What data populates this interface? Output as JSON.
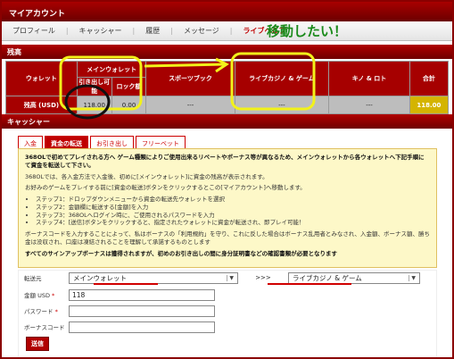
{
  "title": "マイアカウント",
  "nav": [
    "プロフィール",
    "キャッシャー",
    "履歴",
    "メッセージ",
    "ライブヘルプ"
  ],
  "nav_active_index": 4,
  "handwritten_note": "移動したい！",
  "balance": {
    "header": "残高",
    "col_wallet": "ウォレット",
    "col_main": "メインウォレット",
    "col_withdrawable": "引き出し可能",
    "col_locked": "ロック額",
    "col_sportsbook": "スポーツブック",
    "col_live_casino": "ライブカジノ & ゲーム",
    "col_keno": "キノ & ロト",
    "col_total": "合計",
    "row_label": "残高 (USD)",
    "withdrawable": "118.00",
    "locked": "0.00",
    "sportsbook": "---",
    "live_casino": "---",
    "keno": "---",
    "total": "118.00"
  },
  "cashier": {
    "header": "キャッシャー",
    "tabs": [
      "入金",
      "資金の転送",
      "お引き出し",
      "フリーベット"
    ],
    "active_tab": 1
  },
  "info": {
    "p1": "368OLで初めてプレイされる方へ ゲーム種類によりご使用出来るリベートやボーナス等が異なるため、メインウォレットから各ウォレットへ下記手順にて資金を転送して下さい。",
    "p2": "368OLでは、各入金方法で入金後、初めに[メインウォレット]に資金の残高が表示されます。",
    "p3": "お好みのゲームをプレイする前に[資金の転送]ボタンをクリックするとこの[マイアカウント]へ移動します。",
    "steps": [
      "ステップ1：ドロップダウンメニューから資金の転送先ウォレットを選択",
      "ステップ2：金額欄に転送する[金額]を入力",
      "ステップ3：368OLへログイン時に、ご使用されるパスワードを入力",
      "ステップ4：[送信]ボタンをクリックすると、指定されたウォレットに資金が転送され、即プレイ可能！"
    ],
    "p4": "ボーナスコードを入力することによって、私はボーナスの「利用規約」を守り、これに反した場合はボーナス乱用者とみなされ、入金額、ボーナス額、勝ち金は没収され、口座は凍結されることを理解して承諾するものとします",
    "p5": "すべてのサインアップボーナスは獲得されますが、初めのお引き出しの間に身分証明書などの確認書類が必要となります"
  },
  "form": {
    "from_label": "転送元",
    "from_value": "メインウォレット",
    "arrow_text": ">>>",
    "to_value": "ライブカジノ & ゲーム",
    "amount_label": "金額 USD",
    "amount_value": "118",
    "password_label": "パスワード",
    "bonus_label": "ボーナスコード",
    "submit_label": "送信",
    "required_mark": "*"
  },
  "colors": {
    "brand_red": "#c00000",
    "annotation_yellow": "#f2f21a",
    "annotation_green": "#1a8a1a",
    "total_gold": "#d4b400"
  }
}
